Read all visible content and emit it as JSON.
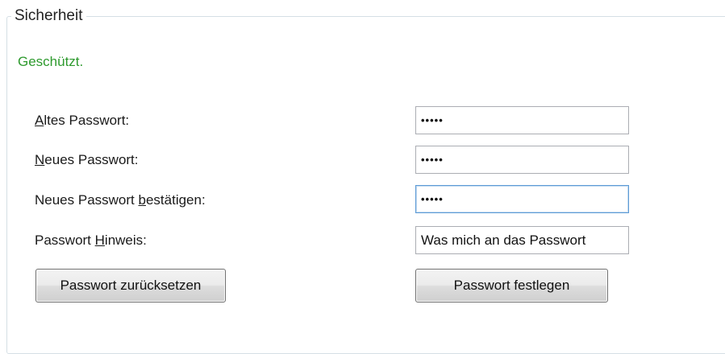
{
  "group": {
    "title": "Sicherheit"
  },
  "status": {
    "text": "Geschützt.",
    "color": "#2e9a2e"
  },
  "fields": {
    "old_password": {
      "label_prefix": "",
      "label_mnemonic": "A",
      "label_suffix": "ltes Passwort:",
      "value": "•••••"
    },
    "new_password": {
      "label_prefix": "",
      "label_mnemonic": "N",
      "label_suffix": "eues Passwort:",
      "value": "•••••"
    },
    "confirm_password": {
      "label_prefix": "Neues Passwort ",
      "label_mnemonic": "b",
      "label_suffix": "estätigen:",
      "value": "•••••"
    },
    "password_hint": {
      "label_prefix": "Passwort ",
      "label_mnemonic": "H",
      "label_suffix": "inweis:",
      "value": "Was mich an das Passwort"
    }
  },
  "buttons": {
    "reset": "Passwort zurücksetzen",
    "set": "Passwort festlegen"
  }
}
